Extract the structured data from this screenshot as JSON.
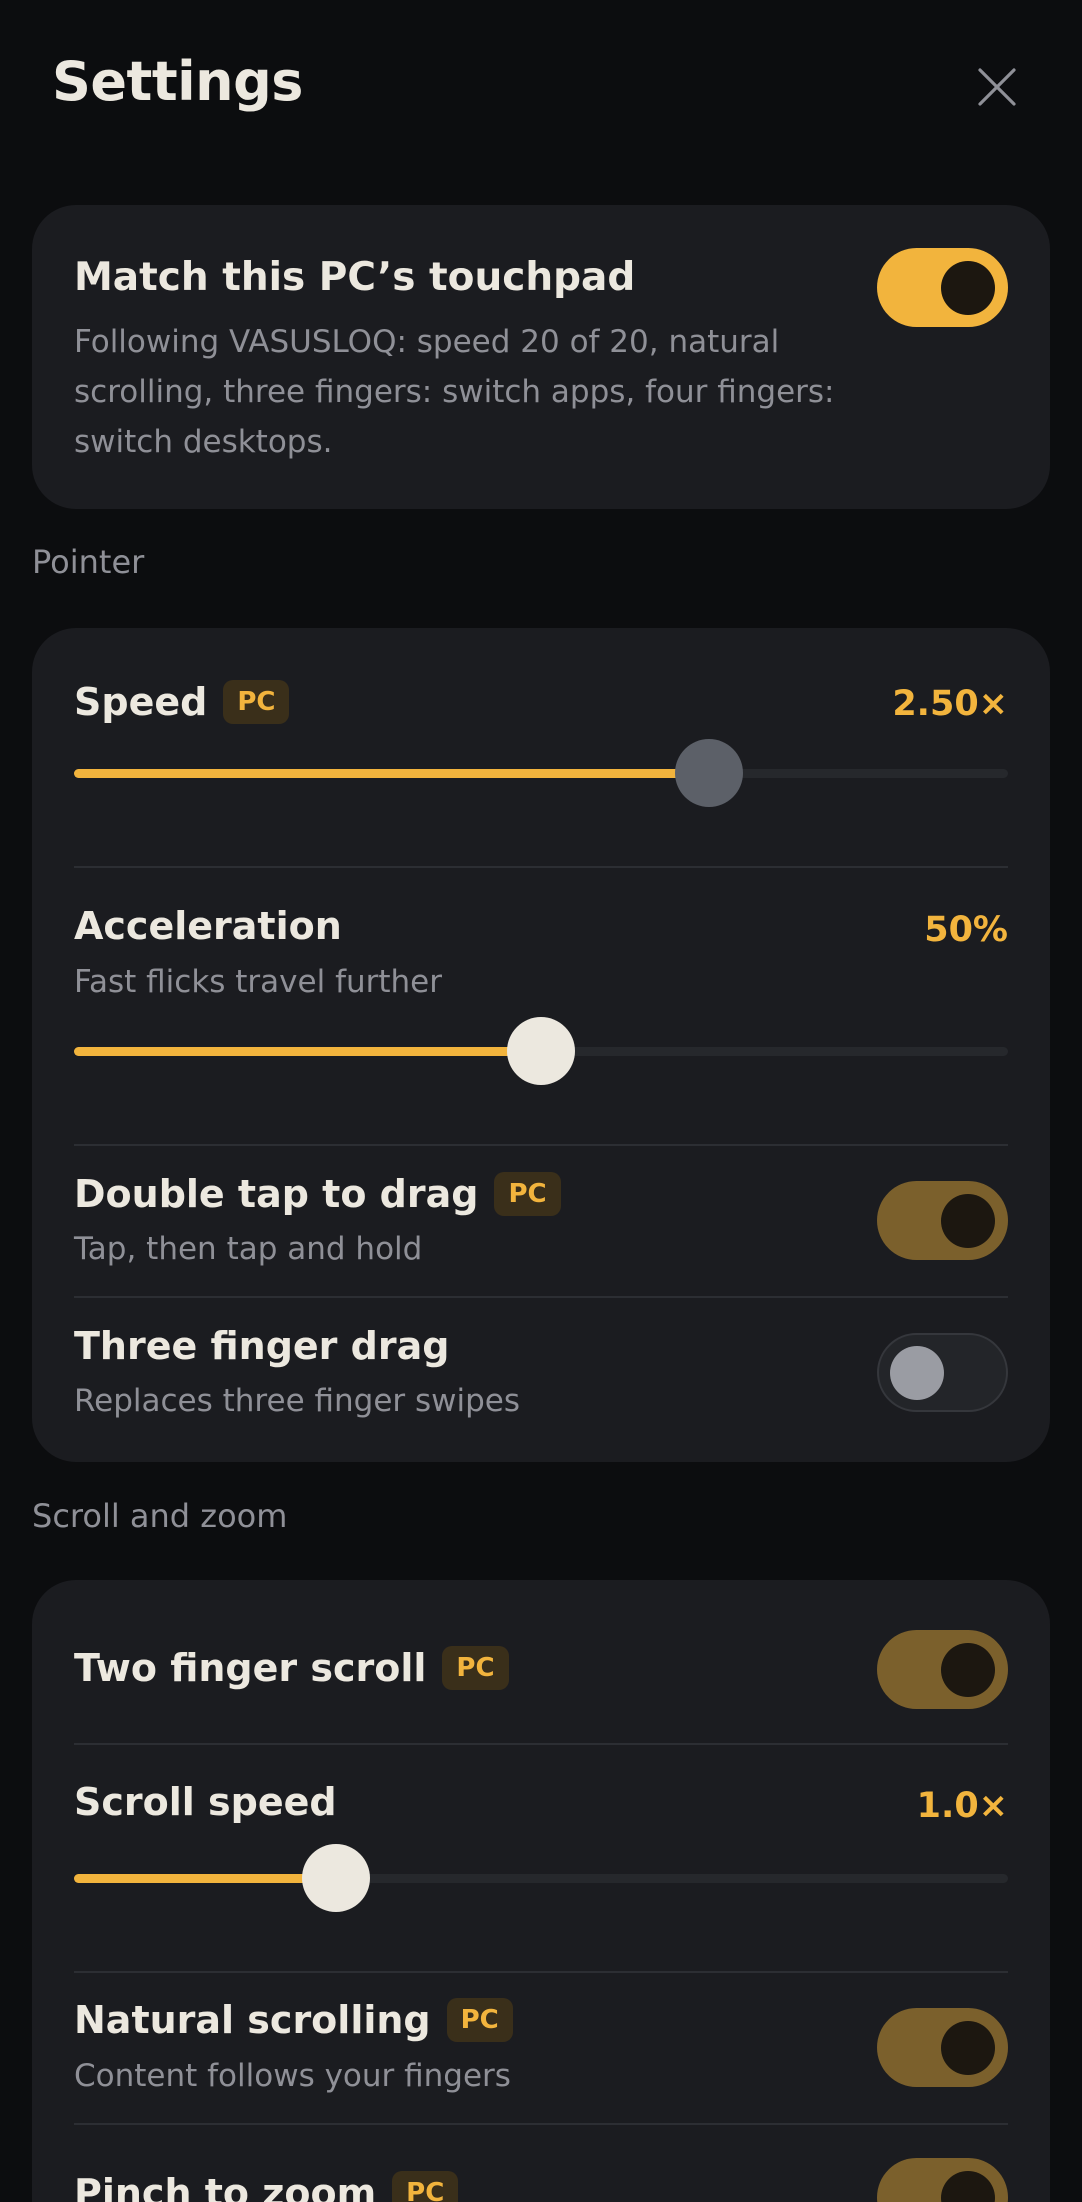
{
  "header": {
    "title": "Settings",
    "close_icon": "close-icon"
  },
  "match": {
    "title": "Match this PC’s touchpad",
    "description": "Following VASUSLOQ: speed 20 of 20, natural scrolling, three fingers: switch apps, four fingers: switch desktops.",
    "enabled": true
  },
  "sections": {
    "pointer": "Pointer",
    "scroll": "Scroll and zoom"
  },
  "pointer": {
    "speed": {
      "label": "Speed",
      "badge": "PC",
      "value": "2.50×",
      "level": 0.68
    },
    "acceleration": {
      "label": "Acceleration",
      "sub": "Fast flicks travel further",
      "value": "50%",
      "level": 0.5
    },
    "double_tap": {
      "label": "Double tap to drag",
      "badge": "PC",
      "sub": "Tap, then tap and hold",
      "enabled": true
    },
    "three_finger": {
      "label": "Three finger drag",
      "sub": "Replaces three finger swipes",
      "enabled": false
    }
  },
  "scroll": {
    "two_finger": {
      "label": "Two finger scroll",
      "badge": "PC",
      "enabled": true
    },
    "scroll_speed": {
      "label": "Scroll speed",
      "value": "1.0×",
      "level": 0.28
    },
    "natural": {
      "label": "Natural scrolling",
      "badge": "PC",
      "sub": "Content follows your fingers",
      "enabled": true
    },
    "pinch": {
      "label": "Pinch to zoom",
      "badge": "PC",
      "enabled": true
    }
  },
  "colors": {
    "accent": "#f2b43d",
    "background": "#0c0d0f",
    "card": "#1b1c20",
    "text": "#ece8df",
    "muted": "#8f9097"
  }
}
